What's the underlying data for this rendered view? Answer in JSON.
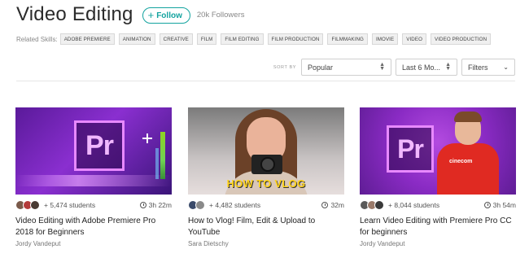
{
  "header": {
    "title": "Video Editing",
    "follow_label": "Follow",
    "followers": "20k Followers"
  },
  "skills": {
    "label": "Related Skills:",
    "tags": [
      "Adobe Premiere",
      "Animation",
      "Creative",
      "Film",
      "Film Editing",
      "Film Production",
      "Filmmaking",
      "iMovie",
      "Video",
      "Video Production"
    ]
  },
  "sort": {
    "label": "SORT BY",
    "selected": "Popular",
    "period": "Last 6 Mo...",
    "filters": "Filters"
  },
  "courses": [
    {
      "students": "+ 5,474 students",
      "duration": "3h 22m",
      "title": "Video Editing with Adobe Premiere Pro 2018 for Beginners",
      "author": "Jordy Vandeput",
      "thumb_text": "Pr"
    },
    {
      "students": "+ 4,482 students",
      "duration": "32m",
      "title": "How to Vlog! Film, Edit & Upload to YouTube",
      "author": "Sara Dietschy",
      "thumb_text": "HOW TO VLOG"
    },
    {
      "students": "+ 8,044 students",
      "duration": "3h 54m",
      "title": "Learn Video Editing with Premiere Pro CC for beginners",
      "author": "Jordy Vandeput",
      "thumb_text": "Pr",
      "shirt_text": "cinecom"
    }
  ],
  "colors": {
    "accent": "#13a39f",
    "premiere_purple": "#8a2fd0"
  }
}
